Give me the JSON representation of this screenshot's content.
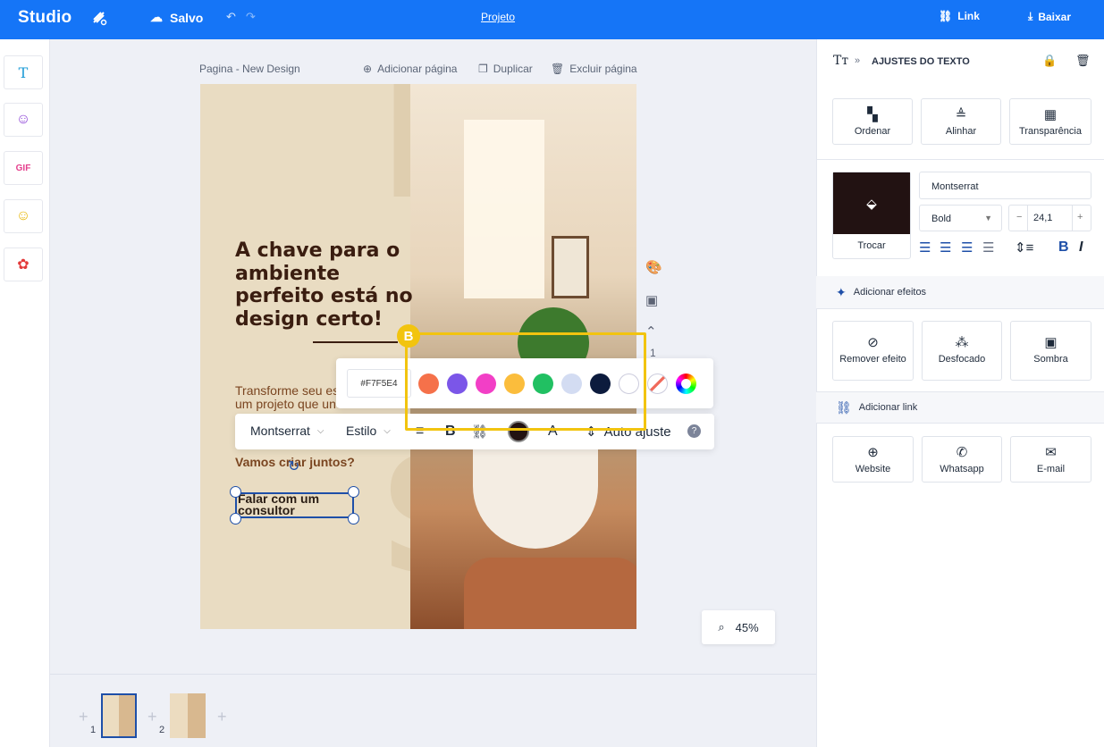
{
  "topbar": {
    "brand": "Studio",
    "saved": "Salvo",
    "project": "Projeto",
    "link": "Link",
    "download": "Baixar"
  },
  "pagebar": {
    "page_name": "Pagina - New Design",
    "add_page": "Adicionar página",
    "duplicate": "Duplicar",
    "delete_page": "Excluir página"
  },
  "canvas": {
    "headline": "A chave para o ambiente perfeito está no design certo!",
    "subtext": "Transforme seu espaço com um projeto que une",
    "cta_question": "Vamos criar juntos?",
    "cta_button": "Falar com um consultor"
  },
  "side_tools": {
    "page_number": "1"
  },
  "palette": {
    "hex": "#F7F5E4",
    "badge": "B",
    "colors": [
      "#f5714a",
      "#7b56e8",
      "#f23fc6",
      "#fbbd3c",
      "#21c062",
      "#d3dcf2",
      "#0c1b3d",
      "#ffffff"
    ]
  },
  "text_toolbar": {
    "font": "Montserrat",
    "style": "Estilo",
    "auto_adjust": "Auto ajuste",
    "help": "?"
  },
  "zoom": {
    "value": "45%"
  },
  "pages": {
    "p1": "1",
    "p2": "2"
  },
  "panel": {
    "title": "AJUSTES DO TEXTO",
    "order": "Ordenar",
    "align": "Alinhar",
    "transparency": "Transparência",
    "font_family": "Montserrat",
    "font_weight": "Bold",
    "font_size": "24,1",
    "swap": "Trocar",
    "effects_title": "Adicionar efeitos",
    "remove_effect": "Remover efeito",
    "blur": "Desfocado",
    "shadow": "Sombra",
    "link_title": "Adicionar link",
    "website": "Website",
    "whatsapp": "Whatsapp",
    "email": "E-mail",
    "color_swatch": "#221212"
  }
}
